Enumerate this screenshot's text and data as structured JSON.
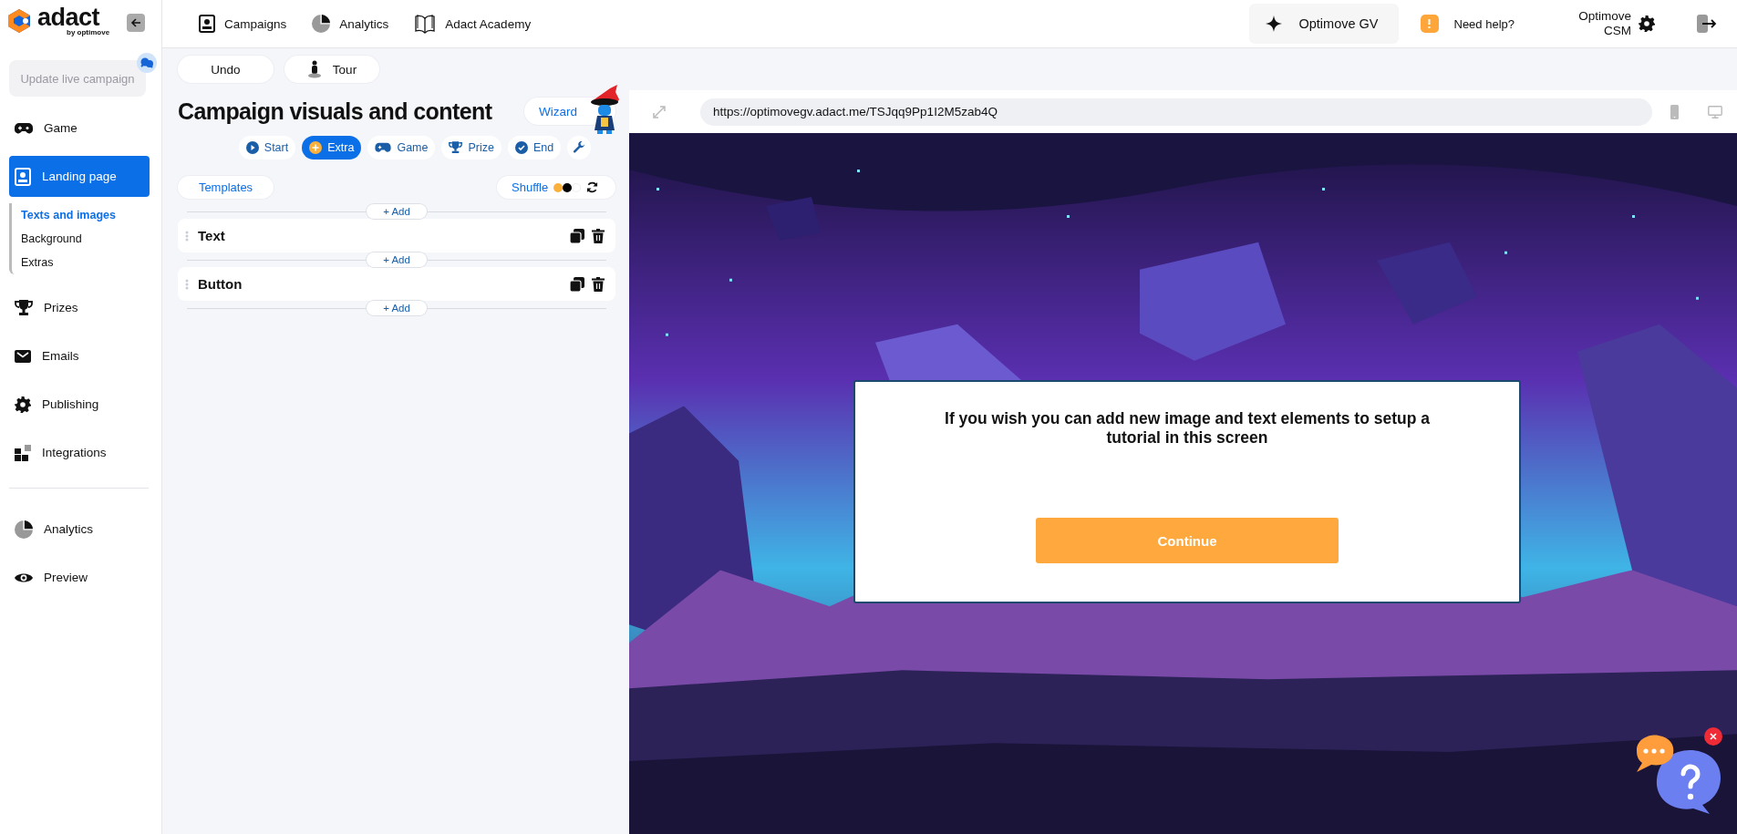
{
  "logo": {
    "name": "adact",
    "tagline": "by optimove"
  },
  "sidebar": {
    "update_button": "Update live campaign",
    "items": [
      {
        "kind": "game",
        "label": "Game",
        "selected": false
      },
      {
        "kind": "landing",
        "label": "Landing page",
        "selected": true,
        "children": [
          {
            "label": "Texts and images",
            "selected": true
          },
          {
            "label": "Background",
            "selected": false
          },
          {
            "label": "Extras",
            "selected": false
          }
        ]
      },
      {
        "kind": "prizes",
        "label": "Prizes",
        "selected": false
      },
      {
        "kind": "emails",
        "label": "Emails",
        "selected": false
      },
      {
        "kind": "publishing",
        "label": "Publishing",
        "selected": false
      },
      {
        "kind": "integrations",
        "label": "Integrations",
        "selected": false
      }
    ],
    "bottom_items": [
      {
        "kind": "analytics",
        "label": "Analytics"
      },
      {
        "kind": "preview",
        "label": "Preview"
      }
    ]
  },
  "top_nav": [
    {
      "kind": "campaigns",
      "label": "Campaigns"
    },
    {
      "kind": "analytics",
      "label": "Analytics"
    },
    {
      "kind": "academy",
      "label": "Adact Academy"
    }
  ],
  "workspace": "Optimove GV",
  "help": "Need help?",
  "user": "Optimove CSM",
  "toolbar": [
    "Undo",
    "Tour"
  ],
  "editor": {
    "title": "Campaign visuals and content",
    "wizard": "Wizard",
    "steps": [
      {
        "kind": "start",
        "label": "Start",
        "selected": false
      },
      {
        "kind": "extra",
        "label": "Extra",
        "selected": true
      },
      {
        "kind": "game",
        "label": "Game",
        "selected": false
      },
      {
        "kind": "prize",
        "label": "Prize",
        "selected": false
      },
      {
        "kind": "end",
        "label": "End",
        "selected": false
      }
    ],
    "templates": "Templates",
    "shuffle": "Shuffle",
    "palette": [
      {
        "color": "#fbb03b"
      },
      {
        "color": "#000000"
      },
      {
        "color": "#ffffff"
      }
    ],
    "elements": [
      {
        "label": "Text"
      },
      {
        "label": "Button"
      }
    ],
    "add_buttons": [
      "+ Add",
      "+ Add",
      "+ Add"
    ]
  },
  "preview": {
    "url": "https://optimovegv.adact.me/TSJqq9Pp1I2M5zab4Q",
    "modal": {
      "text": "If you wish you can add new image and text elements to setup a tutorial in this screen",
      "button": "Continue"
    }
  }
}
